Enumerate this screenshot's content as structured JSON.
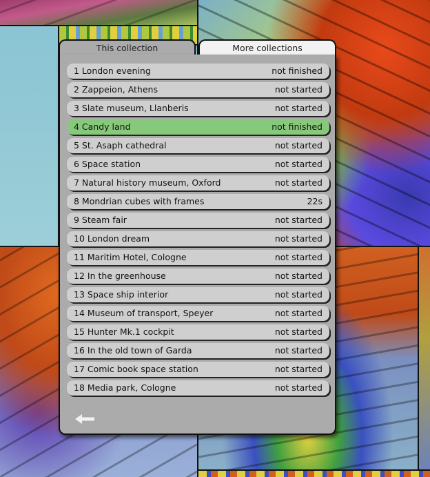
{
  "tabs": {
    "this_collection": "This collection",
    "more_collections": "More collections"
  },
  "puzzles": [
    {
      "name": "1 London evening",
      "status": "not finished"
    },
    {
      "name": "2 Zappeion, Athens",
      "status": "not started"
    },
    {
      "name": "3 Slate museum, Llanberis",
      "status": "not started"
    },
    {
      "name": "4 Candy land",
      "status": "not finished",
      "current": true
    },
    {
      "name": "5 St. Asaph cathedral",
      "status": "not started"
    },
    {
      "name": "6 Space station",
      "status": "not started"
    },
    {
      "name": "7 Natural history museum, Oxford",
      "status": "not started"
    },
    {
      "name": "8 Mondrian cubes with frames",
      "status": "22s"
    },
    {
      "name": "9 Steam fair",
      "status": "not started"
    },
    {
      "name": "10 London dream",
      "status": "not started"
    },
    {
      "name": "11 Maritim Hotel, Cologne",
      "status": "not started"
    },
    {
      "name": "12 In the greenhouse",
      "status": "not started"
    },
    {
      "name": "13 Space ship interior",
      "status": "not started"
    },
    {
      "name": "14 Museum of transport, Speyer",
      "status": "not started"
    },
    {
      "name": "15 Hunter Mk.1 cockpit",
      "status": "not started"
    },
    {
      "name": "16 In the old town of Garda",
      "status": "not started"
    },
    {
      "name": "17 Comic book space station",
      "status": "not started"
    },
    {
      "name": "18 Media park, Cologne",
      "status": "not started"
    }
  ],
  "icons": {
    "back": "back-arrow-icon"
  },
  "colors": {
    "panel": "#ababab",
    "row": "#cfcfcf",
    "current_row": "#87c97b",
    "inactive_tab": "#f2f2f2"
  }
}
